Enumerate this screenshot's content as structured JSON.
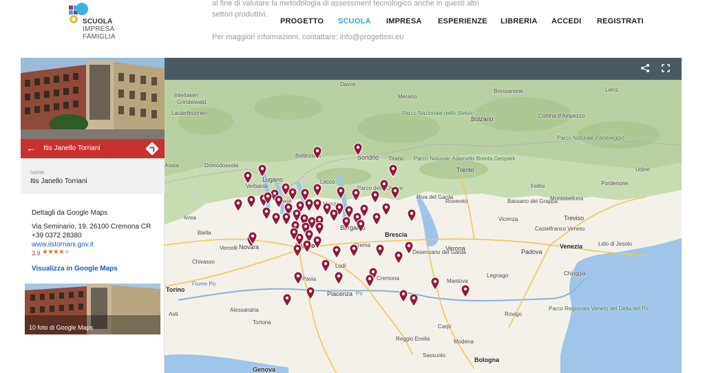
{
  "logo": {
    "line1": "SCUOLA",
    "line2": "IMPRESA",
    "line3": "FAMIGLIA"
  },
  "intro": {
    "text": "al fine di valutare la metodologia di assessment tecnologico anche in questi altri settori produttivi.",
    "contact": "Per maggiori informazioni, contattare: info@progettosi.eu"
  },
  "nav": {
    "items": [
      {
        "label": "PROGETTO"
      },
      {
        "label": "SCUOLA"
      },
      {
        "label": "IMPRESA"
      },
      {
        "label": "ESPERIENZE"
      },
      {
        "label": "LIBRERIA"
      },
      {
        "label": "ACCEDI"
      },
      {
        "label": "REGISTRATI"
      }
    ],
    "active": "SCUOLA"
  },
  "toolbar": {
    "share_icon": "share-icon",
    "fullscreen_icon": "fullscreen-icon"
  },
  "panel": {
    "title": "Itis Janello Torriani",
    "name_label": "nome",
    "name_value": "Itis Janello Torriani",
    "details_heading": "Dettagli da Google Maps",
    "address": "Via Seminario, 19, 26100 Cremona CR",
    "phone": "+39 0372 28380",
    "website": "www.iistorriani.gov.it",
    "rating": "3.9",
    "rating_stars": 4,
    "maps_link": "Visualizza in Google Maps",
    "photos_label": "10 foto di Google Maps",
    "colors": {
      "bar": "#c8322e",
      "link": "#1a57c8",
      "star": "#e7711b"
    }
  },
  "map": {
    "marker_color": "#8e1b3b",
    "place_labels": [
      "Davos",
      "Merano",
      "Bressanone",
      "Lienz",
      "Interlaken",
      "Grindelwald",
      "Lauterbrunnen",
      "Parco Nazionale dello Stelvio",
      "Bolzano",
      "Cortina d'Ampezzo",
      "Parco Naturale Paneveggio",
      "Parco Naturale Adamello Brenta Geopark",
      "Domodossola",
      "Bellinzona",
      "Lugano",
      "Sondrio",
      "Tirano",
      "Parco delle Orobie",
      "Trento",
      "Udine",
      "Lecco",
      "Pordenone",
      "Riva del Garda",
      "Rovereto",
      "Bassano del Grappa",
      "Treviso",
      "Biella",
      "Novara",
      "Milano",
      "Bergamo",
      "Brescia",
      "Verona",
      "Desenzano del Garda",
      "Padova",
      "Venezia",
      "Castelfranco Veneto",
      "Lido di Jesolo",
      "Torino",
      "Pavia",
      "Piacenza",
      "Cremona",
      "Mantova",
      "Chioggia",
      "Alessandria",
      "Asti",
      "Tortona",
      "Carpi",
      "Modena",
      "Reggio Emilia",
      "Bologna",
      "Sassuolo",
      "Genova",
      "Rovigo",
      "Parco Regionale Veneto del Delta del Po",
      "Fiume Po",
      "Po",
      "Monza",
      "Varese",
      "Verbania",
      "Vercelli",
      "Crema",
      "Lodi",
      "Legnago",
      "Vicenza",
      "Feltre",
      "Ivrea",
      "Aosta",
      "Montebelluna",
      "Chivasso"
    ]
  }
}
